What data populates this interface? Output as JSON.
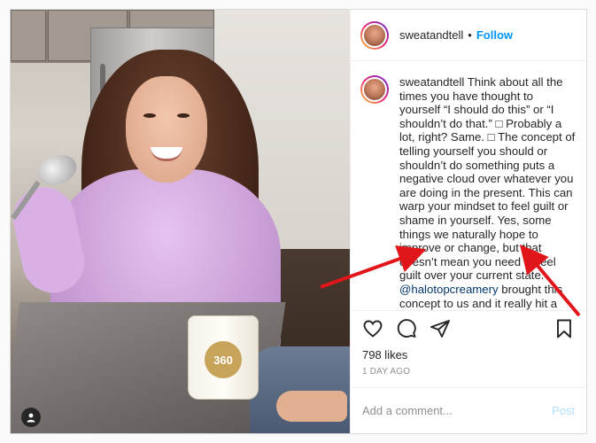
{
  "post": {
    "username": "sweatandtell",
    "separator": "•",
    "follow_label": "Follow",
    "caption_username": "sweatandtell",
    "caption_before": " Think about all the times you have thought to yourself “I should do this” or “I shouldn’t do that.” □ Probably a lot, right? Same. □ The concept of telling yourself you should or shouldn’t do something puts a negative cloud over whatever you are doing in the present. This can warp your mindset to feel guilt or shame in yourself. Yes, some things we naturally hope to improve or change, but that doesn’t mean you need to feel guilt over your current state. ",
    "mention": "@halotopcreamery",
    "caption_after": " brought this concept to us and it really hit a light on how we were treating ourselves. We are always trying to produce positivity into the universe and in turn we try to treat ourselves with the same kindness, but we didn’t",
    "likes": "798 likes",
    "date": "1 DAY AGO",
    "comment_placeholder": "Add a comment...",
    "post_label": "Post",
    "pint_label": "360"
  },
  "icons": [
    "heart-icon",
    "comment-icon",
    "share-icon",
    "bookmark-icon",
    "user-tag-icon"
  ],
  "colors": {
    "link": "#0095f6",
    "mention": "#00376b",
    "annotation_arrow": "#e0161b"
  }
}
